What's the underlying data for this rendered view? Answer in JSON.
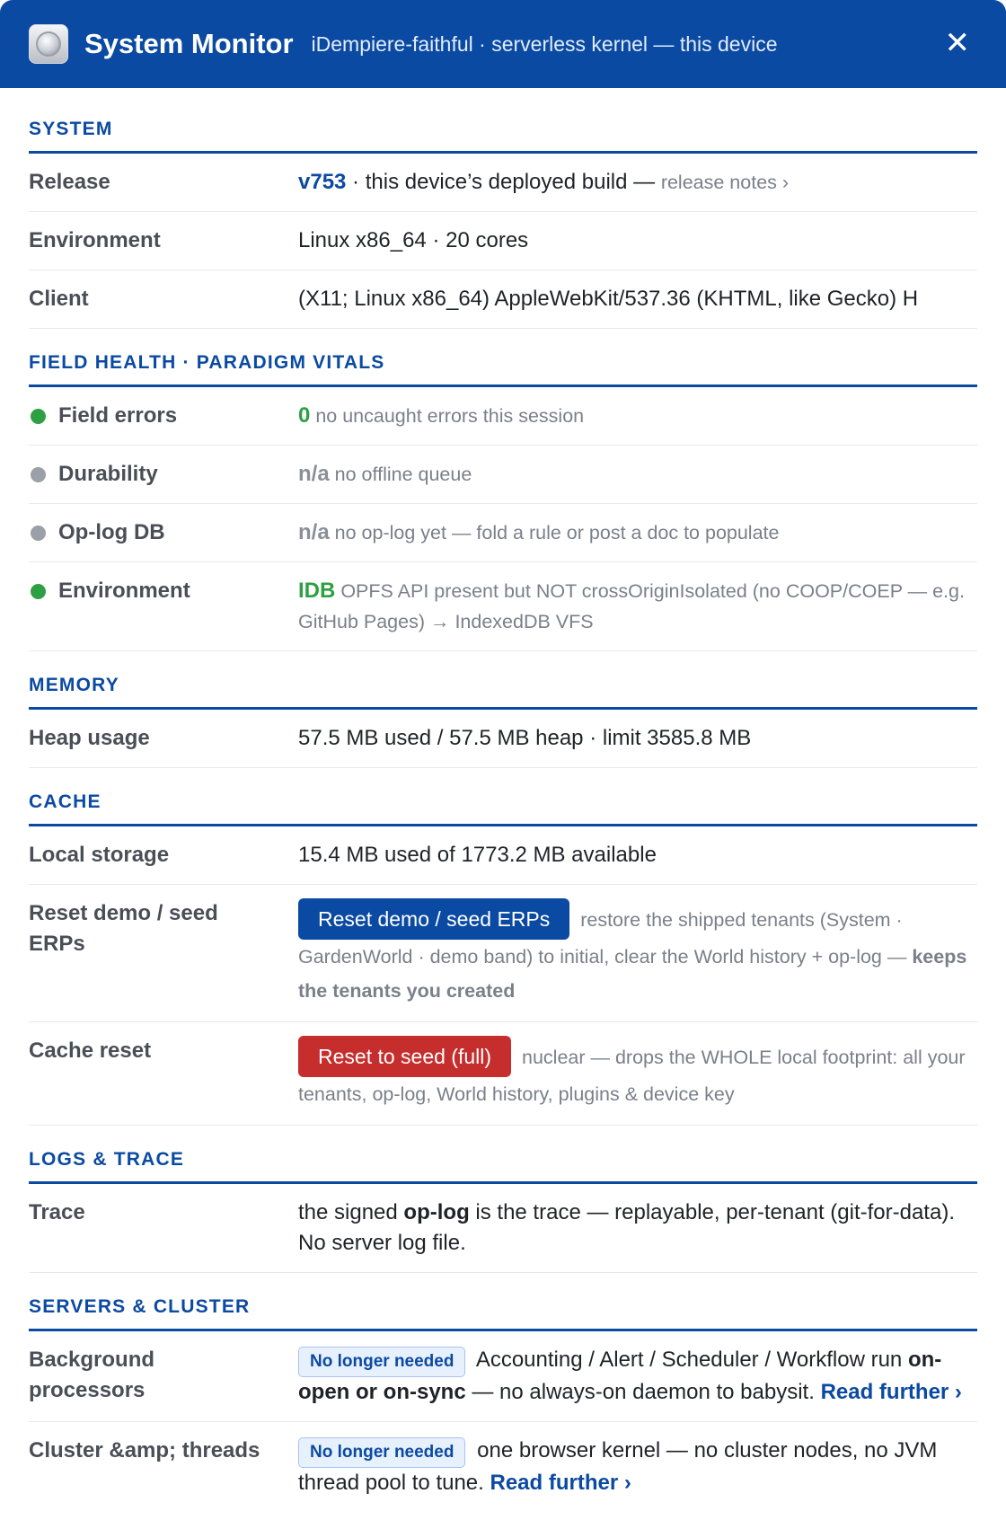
{
  "window": {
    "title": "System Monitor",
    "subtitle": "iDempiere-faithful · serverless kernel — this device",
    "close_glyph": "✕",
    "icon": "app-logo-icon"
  },
  "system": {
    "heading": "SYSTEM",
    "release": {
      "label": "Release",
      "version": "v753",
      "text": " · this device’s deployed build — ",
      "link": "release notes ›"
    },
    "environment": {
      "label": "Environment",
      "value": "Linux x86_64 · 20 cores"
    },
    "client": {
      "label": "Client",
      "value": "(X11; Linux x86_64) AppleWebKit/537.36 (KHTML, like Gecko) H"
    }
  },
  "field_health": {
    "heading": "FIELD HEALTH · PARADIGM VITALS",
    "rows": [
      {
        "label": "Field errors",
        "status": "green",
        "value": "0",
        "note": " no uncaught errors this session"
      },
      {
        "label": "Durability",
        "status": "gray",
        "value": "n/a",
        "note": " no offline queue"
      },
      {
        "label": "Op-log DB",
        "status": "gray",
        "value": "n/a",
        "note": " no op-log yet — fold a rule or post a doc to populate"
      },
      {
        "label": "Environment",
        "status": "green",
        "value": "IDB",
        "note": " OPFS API present but NOT crossOriginIsolated (no COOP/COEP — e.g. GitHub Pages) → IndexedDB VFS"
      }
    ],
    "colors": {
      "green": "#2ea043",
      "gray": "#9aa0a8"
    }
  },
  "memory": {
    "heading": "MEMORY",
    "heap": {
      "label": "Heap usage",
      "value": "57.5 MB used / 57.5 MB heap · limit 3585.8 MB"
    }
  },
  "cache": {
    "heading": "CACHE",
    "local_storage": {
      "label": "Local storage",
      "value": "15.4 MB used of 1773.2 MB available"
    },
    "reset_demo": {
      "label": "Reset demo / seed ERPs",
      "button": "Reset demo / seed ERPs",
      "note": " restore the shipped tenants (System · GardenWorld · demo band) to initial, clear the World history + op-log — ",
      "note_bold": "keeps the tenants you created"
    },
    "cache_reset": {
      "label": "Cache reset",
      "button": "Reset to seed (full)",
      "note": " nuclear — drops the WHOLE local footprint: all your tenants, op-log, World history, plugins & device key"
    }
  },
  "logs": {
    "heading": "LOGS & TRACE",
    "trace": {
      "label": "Trace",
      "pre": "the signed ",
      "bold": "op-log",
      "post": " is the trace — replayable, per-tenant (git-for-data). No server log file."
    }
  },
  "servers": {
    "heading": "SERVERS & CLUSTER",
    "background": {
      "label": "Background processors",
      "badge": "No longer needed",
      "text": " Accounting / Alert / Scheduler / Workflow run ",
      "bold": "on-open or on-sync",
      "post": " — no always-on daemon to babysit. ",
      "link": "Read further ›"
    },
    "cluster": {
      "label": "Cluster &amp; threads",
      "badge": "No longer needed",
      "text": " one browser kernel — no cluster nodes, no JVM thread pool to tune. ",
      "link": "Read further ›"
    }
  },
  "theme": {
    "accent": "#0b4aa2",
    "danger": "#c62d2d",
    "ok": "#2ea043"
  }
}
